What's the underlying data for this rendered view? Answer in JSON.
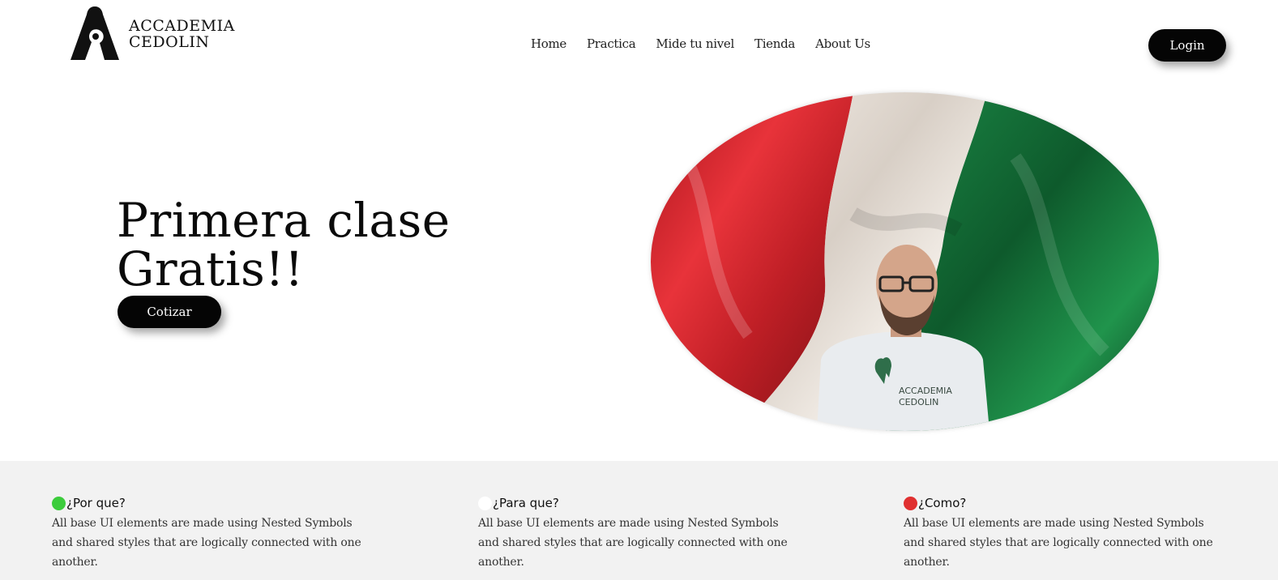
{
  "brand": {
    "line1": "ACCADEMIA",
    "line2": "CEDOLIN"
  },
  "nav": {
    "items": [
      "Home",
      "Practica",
      "Mide tu nivel",
      "Tienda",
      "About Us"
    ]
  },
  "header": {
    "login_label": "Login"
  },
  "hero": {
    "title_line1": "Primera clase",
    "title_line2": "Gratis!!",
    "cta_label": "Cotizar",
    "shirt_text_line1": "ACCADEMIA",
    "shirt_text_line2": "CEDOLIN"
  },
  "features": [
    {
      "title": "¿Por que?",
      "dot_color": "#3ccc3c",
      "body": "All base UI elements are made using Nested Symbols and shared styles that are logically connected with one another."
    },
    {
      "title": "¿Para que?",
      "dot_color": "#ffffff",
      "body": "All base UI elements are made using Nested Symbols and shared styles that are logically connected with one another."
    },
    {
      "title": "¿Como?",
      "dot_color": "#e03030",
      "body": "All base UI elements are made using Nested Symbols and shared styles that are logically connected with one another."
    }
  ],
  "colors": {
    "button_bg": "#050505",
    "band_bg": "#f2f2f2",
    "flag_red": "#d42a2a",
    "flag_white": "#efe9e4",
    "flag_green": "#1e7a3e"
  },
  "icons": [
    "logo-icon"
  ]
}
